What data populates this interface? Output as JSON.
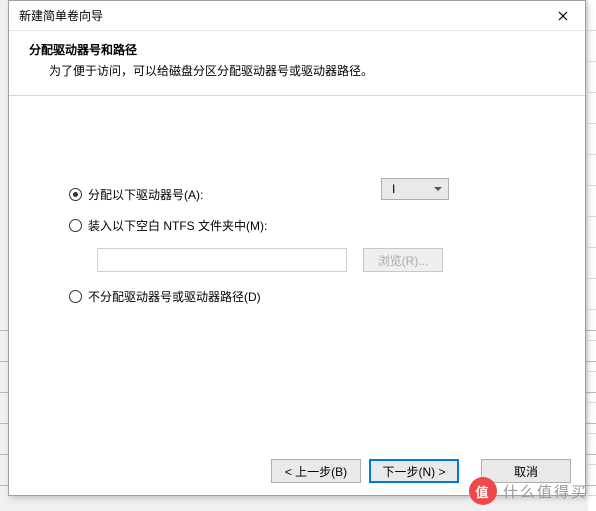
{
  "window": {
    "title": "新建简单卷向导"
  },
  "header": {
    "heading": "分配驱动器号和路径",
    "sub": "为了便于访问，可以给磁盘分区分配驱动器号或驱动器路径。"
  },
  "options": {
    "assign": {
      "label": "分配以下驱动器号(A):",
      "checked": true
    },
    "mount": {
      "label": "装入以下空白 NTFS 文件夹中(M):",
      "checked": false
    },
    "none": {
      "label": "不分配驱动器号或驱动器路径(D)",
      "checked": false
    }
  },
  "drive": {
    "selected": "I"
  },
  "path": {
    "value": "",
    "browse_label": "浏览(R)..."
  },
  "footer": {
    "back": "< 上一步(B)",
    "next": "下一步(N) >",
    "cancel": "取消"
  },
  "watermark": {
    "badge": "值",
    "text": "什么值得买"
  }
}
